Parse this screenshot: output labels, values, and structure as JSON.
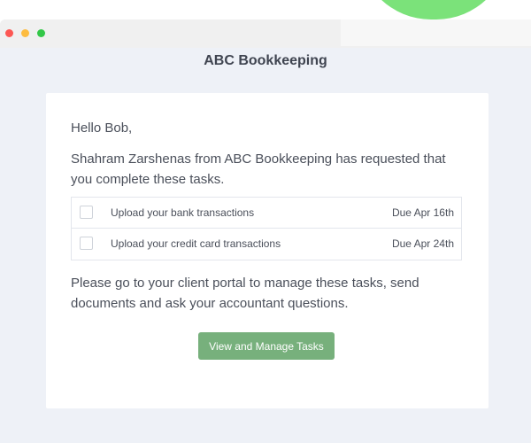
{
  "header": {
    "brand": "ABC Bookkeeping"
  },
  "email": {
    "greeting": "Hello Bob,",
    "intro": "Shahram Zarshenas from ABC Bookkeeping has requested that you complete these tasks.",
    "tasks": [
      {
        "label": "Upload your bank transactions",
        "due": "Due Apr 16th",
        "checked": false
      },
      {
        "label": "Upload your credit card transactions",
        "due": "Due Apr 24th",
        "checked": false
      }
    ],
    "outro": "Please go to your client portal to manage these tasks, send documents and ask your accountant questions.",
    "cta_label": "View and Manage Tasks"
  },
  "colors": {
    "cta_background": "#77b07c",
    "page_background": "#eef1f7",
    "accent_green": "#7be27a"
  }
}
